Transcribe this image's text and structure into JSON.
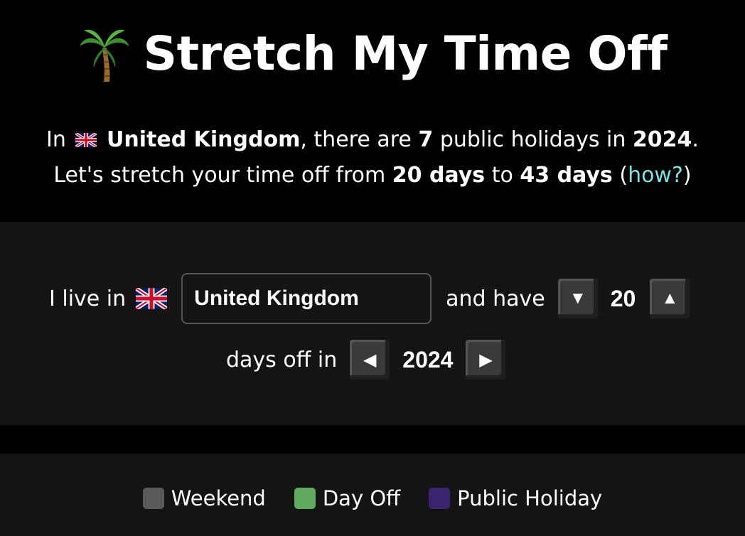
{
  "header": {
    "title": "Stretch My Time Off",
    "icon": "palm-tree-icon"
  },
  "intro": {
    "line1_prefix": "In",
    "country": "United Kingdom",
    "line1_mid": ", there are",
    "holiday_count": "7",
    "line1_mid2": "public holidays in",
    "year": "2024",
    "line1_end": ".",
    "line2_prefix": "Let's stretch your time off from",
    "days_from": "20 days",
    "line2_mid": "to",
    "days_to": "43 days",
    "paren_open": "(",
    "how_link": "how?",
    "paren_close": ")"
  },
  "controls": {
    "live_in_label": "I live in",
    "country_value": "United Kingdom",
    "and_have_label": "and have",
    "decrease_symbol": "▼",
    "days_value": "20",
    "increase_symbol": "▲",
    "days_off_label": "days off in",
    "prev_year_symbol": "◀",
    "year_value": "2024",
    "next_year_symbol": "▶"
  },
  "legend": {
    "items": [
      {
        "label": "Weekend",
        "color": "#5a5a5a"
      },
      {
        "label": "Day Off",
        "color": "#5faa5f"
      },
      {
        "label": "Public Holiday",
        "color": "#3a2470"
      }
    ]
  },
  "colors": {
    "background": "#000000",
    "panel": "#141414",
    "link": "#7fe0e0"
  }
}
